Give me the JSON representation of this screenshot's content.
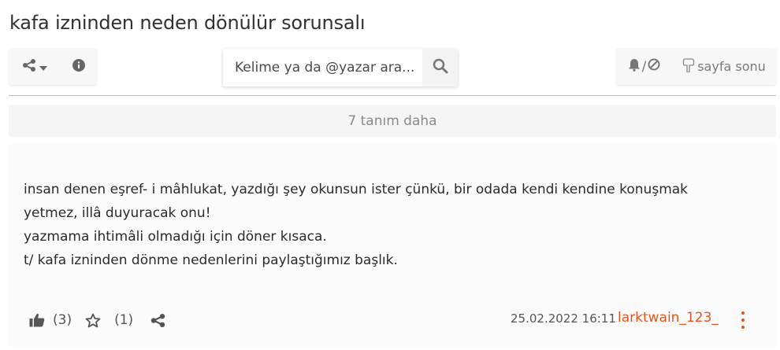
{
  "topic": {
    "title": "kafa izninden neden dönülür sorunsalı"
  },
  "toolbar": {
    "share_icon": "share-icon",
    "dropdown_icon": "caret-down-icon",
    "info_icon": "info-icon",
    "search_placeholder": "Kelime ya da @yazar ara...",
    "search_icon": "search-icon",
    "bell_icon": "bell-icon",
    "notif_separator": "/",
    "block_icon": "block-icon",
    "page_bottom_icon": "hand-pointing-down-icon",
    "page_bottom_label": "sayfa sonu"
  },
  "more_entries": {
    "label": "7 tanım daha"
  },
  "entry": {
    "lines": [
      "insan denen eşref- i mâhlukat, yazdığı şey okunsun ister çünkü, bir odada kendi kendine konuşmak",
      "yetmez, illâ duyuracak onu!",
      "yazmama ihtimâli olmadığı için döner kısaca.",
      "",
      "t/ kafa izninden dönme nedenlerini paylaştığımız başlık."
    ],
    "like_icon": "thumbs-up-icon",
    "like_count": "(3)",
    "favorite_icon": "star-icon",
    "favorite_count": "(1)",
    "share_icon": "share-icon",
    "date": "25.02.2022 16:11",
    "author": "larktwain_123_",
    "menu_icon": "vertical-dots-icon"
  },
  "colors": {
    "accent": "#e6541d",
    "toolbar_bg": "#f7f7f7",
    "entry_bg": "#fbfbfb"
  }
}
